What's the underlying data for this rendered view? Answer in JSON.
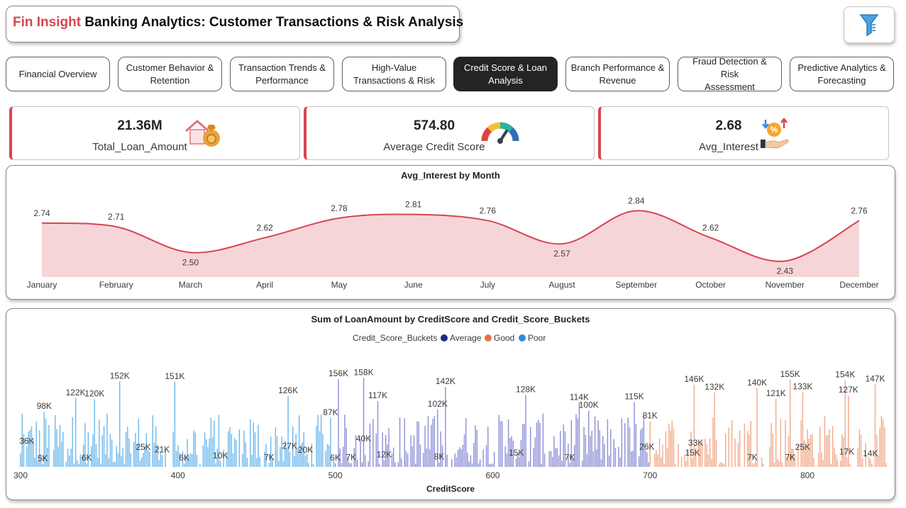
{
  "header": {
    "brand": "Fin Insight",
    "title": " Banking Analytics: Customer Transactions & Risk Analysis"
  },
  "filter_icon": "funnel-icon",
  "tabs": [
    {
      "line1": "Financial Overview",
      "line2": "",
      "active": false
    },
    {
      "line1": "Customer Behavior &",
      "line2": "Retention",
      "active": false
    },
    {
      "line1": "Transaction Trends &",
      "line2": "Performance",
      "active": false
    },
    {
      "line1": "High-Value",
      "line2": "Transactions & Risk",
      "active": false
    },
    {
      "line1": "Credit Score & Loan",
      "line2": "Analysis",
      "active": true
    },
    {
      "line1": "Branch Performance &",
      "line2": "Revenue",
      "active": false
    },
    {
      "line1": "Fraud Detection & Risk",
      "line2": "Assessment",
      "active": false
    },
    {
      "line1": "Predictive Analytics &",
      "line2": "Forecasting",
      "active": false
    }
  ],
  "kpis": [
    {
      "value": "21.36M",
      "label": "Total_Loan_Amount",
      "icon": "money-bag-house-icon"
    },
    {
      "value": "574.80",
      "label": "Average Credit Score",
      "icon": "gauge-icon"
    },
    {
      "value": "2.68",
      "label": "Avg_Interest",
      "icon": "percent-hand-icon"
    }
  ],
  "colors": {
    "accent": "#d64550",
    "line": "#d64550",
    "area": "#f6d5d8",
    "average": "#8b8fd6",
    "good": "#f2a98a",
    "poor": "#6cb7ec",
    "legend_average": "#1f2a8c",
    "legend_good": "#e8703e",
    "legend_poor": "#2f8ae6"
  },
  "chart_data": [
    {
      "type": "area",
      "title": "Avg_Interest by Month",
      "xlabel": "",
      "ylabel": "",
      "x": [
        "January",
        "February",
        "March",
        "April",
        "May",
        "June",
        "July",
        "August",
        "September",
        "October",
        "November",
        "December"
      ],
      "values": [
        2.74,
        2.71,
        2.5,
        2.62,
        2.78,
        2.81,
        2.76,
        2.57,
        2.84,
        2.62,
        2.43,
        2.76
      ],
      "labels": [
        "2.74",
        "2.71",
        "2.50",
        "2.62",
        "2.78",
        "2.81",
        "2.76",
        "2.57",
        "2.84",
        "2.62",
        "2.43",
        "2.76"
      ],
      "grid": false
    },
    {
      "type": "bar",
      "title": "Sum of LoanAmount by CreditScore and Credit_Score_Buckets",
      "xlabel": "CreditScore",
      "ylabel": "",
      "legend_title": "Credit_Score_Buckets",
      "legend": [
        "Average",
        "Good",
        "Poor"
      ],
      "legend_placement": "top-center",
      "xlim": [
        300,
        850
      ],
      "x_ticks": [
        300,
        400,
        500,
        600,
        700,
        800
      ],
      "ylim": [
        0,
        170000
      ],
      "data_labels": [
        {
          "x": 304,
          "value": 36000,
          "text": "36K"
        },
        {
          "x": 315,
          "value": 98000,
          "text": "98K"
        },
        {
          "x": 314,
          "value": 5000,
          "text": "5K"
        },
        {
          "x": 335,
          "value": 122000,
          "text": "122K"
        },
        {
          "x": 347,
          "value": 120000,
          "text": "120K"
        },
        {
          "x": 342,
          "value": 6000,
          "text": "6K"
        },
        {
          "x": 363,
          "value": 152000,
          "text": "152K"
        },
        {
          "x": 378,
          "value": 25000,
          "text": "25K"
        },
        {
          "x": 390,
          "value": 21000,
          "text": "21K"
        },
        {
          "x": 398,
          "value": 151000,
          "text": "151K"
        },
        {
          "x": 404,
          "value": 6000,
          "text": "6K"
        },
        {
          "x": 427,
          "value": 10000,
          "text": "10K"
        },
        {
          "x": 458,
          "value": 7000,
          "text": "7K"
        },
        {
          "x": 470,
          "value": 126000,
          "text": "126K"
        },
        {
          "x": 471,
          "value": 27000,
          "text": "27K"
        },
        {
          "x": 481,
          "value": 20000,
          "text": "20K"
        },
        {
          "x": 497,
          "value": 87000,
          "text": "87K"
        },
        {
          "x": 502,
          "value": 156000,
          "text": "156K"
        },
        {
          "x": 500,
          "value": 6000,
          "text": "6K"
        },
        {
          "x": 510,
          "value": 7000,
          "text": "7K"
        },
        {
          "x": 518,
          "value": 158000,
          "text": "158K"
        },
        {
          "x": 518,
          "value": 40000,
          "text": "40K"
        },
        {
          "x": 527,
          "value": 117000,
          "text": "117K"
        },
        {
          "x": 531,
          "value": 12000,
          "text": "12K"
        },
        {
          "x": 565,
          "value": 102000,
          "text": "102K"
        },
        {
          "x": 570,
          "value": 142000,
          "text": "142K"
        },
        {
          "x": 566,
          "value": 8000,
          "text": "8K"
        },
        {
          "x": 615,
          "value": 15000,
          "text": "15K"
        },
        {
          "x": 621,
          "value": 128000,
          "text": "128K"
        },
        {
          "x": 649,
          "value": 7000,
          "text": "7K"
        },
        {
          "x": 655,
          "value": 114000,
          "text": "114K"
        },
        {
          "x": 661,
          "value": 100000,
          "text": "100K"
        },
        {
          "x": 690,
          "value": 115000,
          "text": "115K"
        },
        {
          "x": 700,
          "value": 81000,
          "text": "81K"
        },
        {
          "x": 698,
          "value": 26000,
          "text": "26K"
        },
        {
          "x": 728,
          "value": 146000,
          "text": "146K"
        },
        {
          "x": 729,
          "value": 33000,
          "text": "33K"
        },
        {
          "x": 727,
          "value": 15000,
          "text": "15K"
        },
        {
          "x": 741,
          "value": 132000,
          "text": "132K"
        },
        {
          "x": 768,
          "value": 140000,
          "text": "140K"
        },
        {
          "x": 765,
          "value": 7000,
          "text": "7K"
        },
        {
          "x": 780,
          "value": 121000,
          "text": "121K"
        },
        {
          "x": 789,
          "value": 155000,
          "text": "155K"
        },
        {
          "x": 789,
          "value": 7000,
          "text": "7K"
        },
        {
          "x": 797,
          "value": 133000,
          "text": "133K"
        },
        {
          "x": 797,
          "value": 25000,
          "text": "25K"
        },
        {
          "x": 824,
          "value": 154000,
          "text": "154K"
        },
        {
          "x": 826,
          "value": 127000,
          "text": "127K"
        },
        {
          "x": 825,
          "value": 17000,
          "text": "17K"
        },
        {
          "x": 843,
          "value": 147000,
          "text": "147K"
        },
        {
          "x": 840,
          "value": 14000,
          "text": "14K"
        }
      ],
      "buckets": [
        {
          "name": "Poor",
          "range": [
            300,
            500
          ]
        },
        {
          "name": "Average",
          "range": [
            500,
            700
          ]
        },
        {
          "name": "Good",
          "range": [
            700,
            850
          ]
        }
      ]
    }
  ]
}
